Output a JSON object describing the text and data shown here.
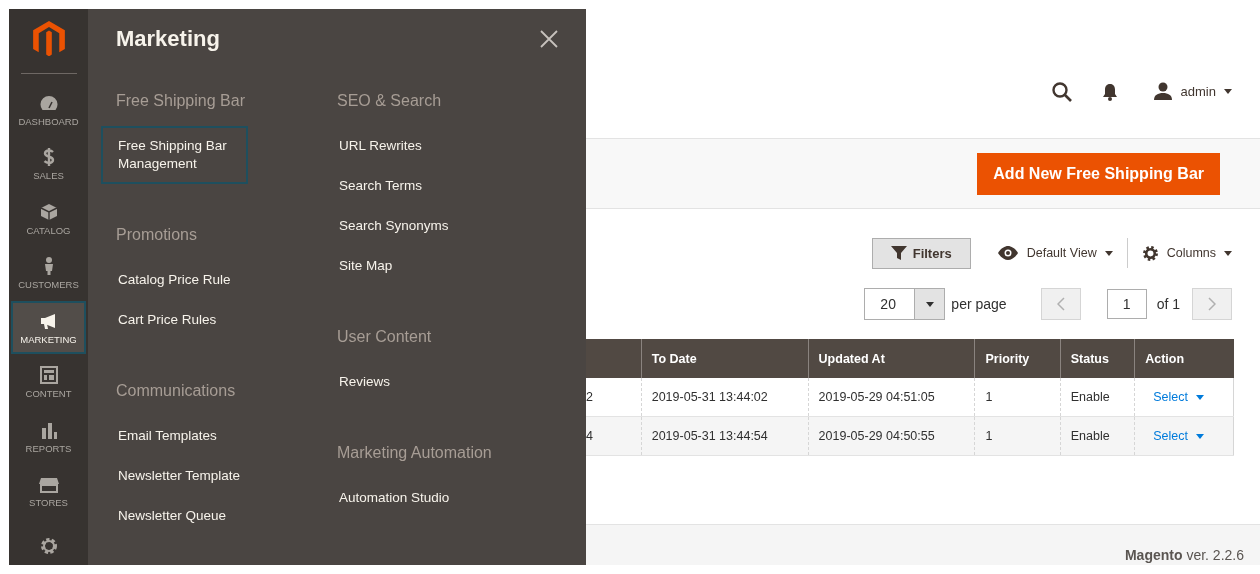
{
  "sidebar": {
    "items": [
      {
        "kind": "dashboard",
        "label": "DASHBOARD",
        "selected": false
      },
      {
        "kind": "sales",
        "label": "SALES",
        "selected": false
      },
      {
        "kind": "catalog",
        "label": "CATALOG",
        "selected": false
      },
      {
        "kind": "customers",
        "label": "CUSTOMERS",
        "selected": false
      },
      {
        "kind": "marketing",
        "label": "MARKETING",
        "selected": true
      },
      {
        "kind": "content",
        "label": "CONTENT",
        "selected": false
      },
      {
        "kind": "reports",
        "label": "REPORTS",
        "selected": false
      },
      {
        "kind": "stores",
        "label": "STORES",
        "selected": false
      },
      {
        "kind": "system",
        "selected": false
      }
    ]
  },
  "flyout": {
    "title": "Marketing",
    "columns": [
      [
        {
          "section": "Free Shipping Bar",
          "items": [
            {
              "label": "Free Shipping Bar Management",
              "selected": true
            }
          ]
        },
        {
          "section": "Promotions",
          "items": [
            {
              "label": "Catalog Price Rule",
              "selected": false
            },
            {
              "label": "Cart Price Rules",
              "selected": false
            }
          ]
        },
        {
          "section": "Communications",
          "items": [
            {
              "label": "Email Templates",
              "selected": false
            },
            {
              "label": "Newsletter Template",
              "selected": false
            },
            {
              "label": "Newsletter Queue",
              "selected": false
            }
          ]
        }
      ],
      [
        {
          "section": "SEO & Search",
          "items": [
            {
              "label": "URL Rewrites",
              "selected": false
            },
            {
              "label": "Search Terms",
              "selected": false
            },
            {
              "label": "Search Synonyms",
              "selected": false
            },
            {
              "label": "Site Map",
              "selected": false
            }
          ]
        },
        {
          "section": "User Content",
          "items": [
            {
              "label": "Reviews",
              "selected": false
            }
          ]
        },
        {
          "section": "Marketing Automation",
          "items": [
            {
              "label": "Automation Studio",
              "selected": false
            }
          ]
        }
      ]
    ]
  },
  "header": {
    "user": "admin"
  },
  "action_bar": {
    "button": "Add New Free Shipping Bar"
  },
  "toolbar": {
    "filters": "Filters",
    "view": "Default View",
    "columns": "Columns"
  },
  "pagination": {
    "per_page": "20",
    "per_page_label": "per page",
    "page": "1",
    "of": "of 1"
  },
  "table": {
    "columns": [
      {
        "label": "To Date",
        "kind": "text"
      },
      {
        "label": "Updated At",
        "kind": "text"
      },
      {
        "label": "Priority",
        "kind": "text"
      },
      {
        "label": "Status",
        "kind": "text"
      },
      {
        "label": "Action",
        "kind": "action"
      }
    ],
    "rows": [
      {
        "column_1": "2",
        "cells": [
          "2019-05-31 13:44:02",
          "2019-05-29 04:51:05",
          "1",
          "Enable",
          "Select"
        ]
      },
      {
        "column_1": "4",
        "cells": [
          "2019-05-31 13:44:54",
          "2019-05-29 04:50:55",
          "1",
          "Enable",
          "Select"
        ]
      }
    ]
  },
  "footer": {
    "text": "**Magento** ver. 2.2.6"
  }
}
